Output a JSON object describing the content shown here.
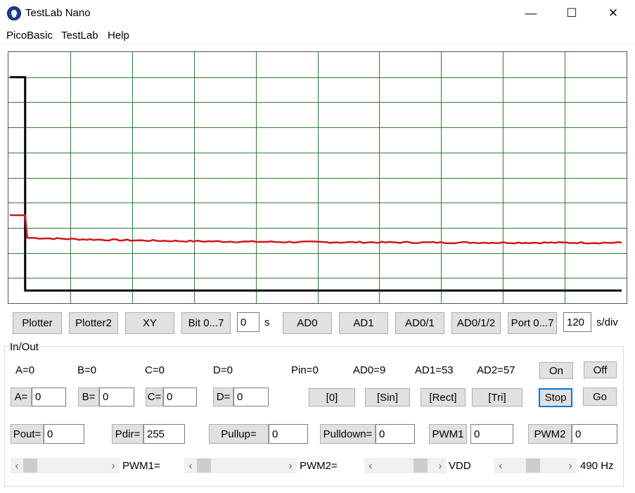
{
  "window": {
    "title": "TestLab Nano",
    "minimize_glyph": "—",
    "maximize_glyph": "☐",
    "close_glyph": "✕"
  },
  "menu": [
    "PicoBasic",
    "TestLab",
    "Help"
  ],
  "plot": {
    "grid_color": "#2e7d32",
    "trace_colors": {
      "black": "#000000",
      "red": "#d01818"
    },
    "black_trace": {
      "initial_level": 0.9,
      "drop_at": 0.025,
      "final_level": 0.05
    },
    "red_trace": {
      "initial_level": 0.35,
      "step_at": 0.025,
      "level_after_step": 0.26,
      "final_level": 0.24
    }
  },
  "mode_buttons": {
    "plotter": "Plotter",
    "plotter2": "Plotter2",
    "xy": "XY",
    "bits": "Bit 0...7",
    "time_value": "0",
    "time_unit": "s",
    "ad0": "AD0",
    "ad1": "AD1",
    "ad01": "AD0/1",
    "ad012": "AD0/1/2",
    "port": "Port 0...7",
    "sdiv_value": "120",
    "sdiv_unit": "s/div"
  },
  "io": {
    "group_title": "In/Out",
    "readouts": {
      "a": "A=0",
      "b": "B=0",
      "c": "C=0",
      "d": "D=0",
      "pin": "Pin=0",
      "ad0": "AD0=9",
      "ad1": "AD1=53",
      "ad2": "AD2=57"
    },
    "on": "On",
    "off": "Off",
    "set_a": {
      "label": "A=",
      "value": "0"
    },
    "set_b": {
      "label": "B=",
      "value": "0"
    },
    "set_c": {
      "label": "C=",
      "value": "0"
    },
    "set_d": {
      "label": "D=",
      "value": "0"
    },
    "wave_zero": "[0]",
    "wave_sin": "[Sin]",
    "wave_rect": "[Rect]",
    "wave_tri": "[Tri]",
    "stop": "Stop",
    "go": "Go",
    "pout": {
      "label": "Pout=",
      "value": "0"
    },
    "pdir": {
      "label": "Pdir=",
      "value": "255"
    },
    "pullup": {
      "label": "Pullup=",
      "value": "0"
    },
    "pulldown": {
      "label": "Pulldown=",
      "value": "0"
    },
    "pwm1": {
      "label": "PWM1",
      "value": "0"
    },
    "pwm2": {
      "label": "PWM2",
      "value": "0"
    },
    "sliders": {
      "pwm1": {
        "label": "PWM1=",
        "value": 0.0
      },
      "pwm2": {
        "label": "PWM2=",
        "value": 0.0
      },
      "vdd": {
        "label": "VDD",
        "value": 0.85
      },
      "freq": {
        "label": "490 Hz",
        "value": 0.45
      }
    }
  }
}
